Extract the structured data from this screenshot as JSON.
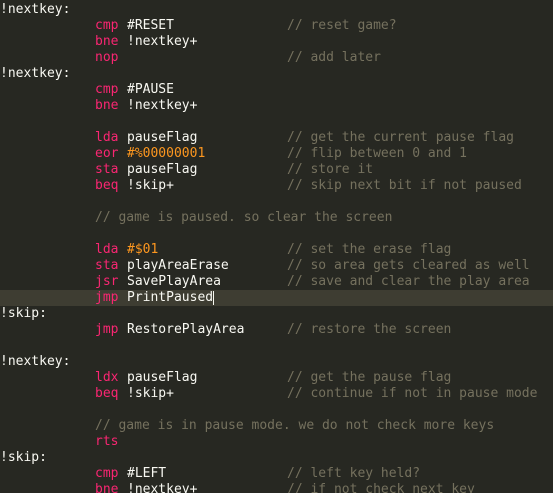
{
  "editor": {
    "language": "6502 assembly",
    "theme": {
      "background": "#272822",
      "current_line": "#3e3d32",
      "label": "#f8f8f2",
      "mnemonic": "#f92672",
      "operand": "#f8f8f2",
      "number": "#ae81ff",
      "binary_literal": "#fd971f",
      "comment": "#75715e"
    },
    "cursor_line": 18,
    "lines": [
      {
        "label": "!nextkey:"
      },
      {
        "op": "cmp",
        "arg": "#RESET",
        "comment": "// reset game?"
      },
      {
        "op": "bne",
        "arg": "!nextkey+"
      },
      {
        "op": "nop",
        "comment": "// add later"
      },
      {
        "label": "!nextkey:"
      },
      {
        "op": "cmp",
        "arg": "#PAUSE"
      },
      {
        "op": "bne",
        "arg": "!nextkey+"
      },
      {},
      {
        "op": "lda",
        "arg": "pauseFlag",
        "comment": "// get the current pause flag"
      },
      {
        "op": "eor",
        "arg": "#%00000001",
        "arg_style": "imm",
        "comment": "// flip between 0 and 1"
      },
      {
        "op": "sta",
        "arg": "pauseFlag",
        "comment": "// store it"
      },
      {
        "op": "beq",
        "arg": "!skip+",
        "comment": "// skip next bit if not paused"
      },
      {},
      {
        "full_comment": "// game is paused. so clear the screen"
      },
      {},
      {
        "op": "lda",
        "arg": "#$01",
        "arg_style": "imm",
        "comment": "// set the erase flag"
      },
      {
        "op": "sta",
        "arg": "playAreaErase",
        "comment": "// so area gets cleared as well"
      },
      {
        "op": "jsr",
        "arg": "SavePlayArea",
        "comment": "// save and clear the play area"
      },
      {
        "op": "jmp",
        "arg": "PrintPaused"
      },
      {
        "label": "!skip:"
      },
      {
        "op": "jmp",
        "arg": "RestorePlayArea",
        "comment": "// restore the screen"
      },
      {},
      {
        "label": "!nextkey:"
      },
      {
        "op": "ldx",
        "arg": "pauseFlag",
        "comment": "// get the pause flag"
      },
      {
        "op": "beq",
        "arg": "!skip+",
        "comment": "// continue if not in pause mode"
      },
      {},
      {
        "full_comment": "// game is in pause mode. we do not check more keys"
      },
      {
        "op": "rts"
      },
      {
        "label": "!skip:"
      },
      {
        "op": "cmp",
        "arg": "#LEFT",
        "comment": "// left key held?"
      },
      {
        "op": "bne",
        "arg": "!nextkey+",
        "comment": "// if not check next key"
      }
    ]
  }
}
